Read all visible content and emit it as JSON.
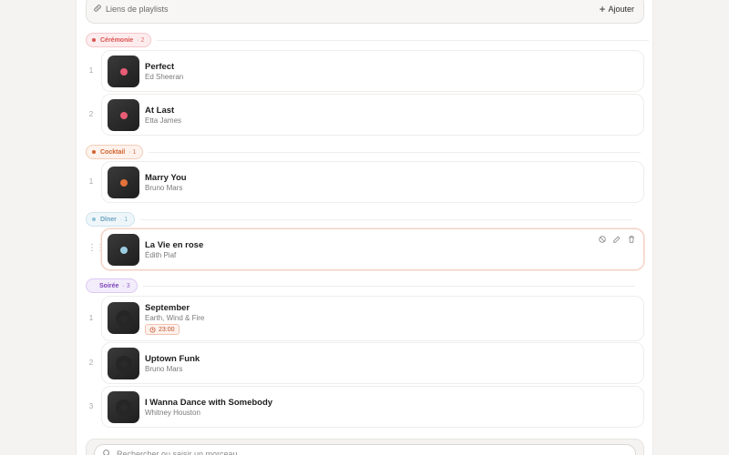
{
  "links_bar": {
    "label": "Liens de playlists",
    "add_label": "Ajouter"
  },
  "sections": [
    {
      "name": "Cérémonie",
      "count": "2",
      "color": "#d9534f",
      "bg": "#fdecee",
      "border": "#f5c6cb",
      "tracks": [
        {
          "index": "1",
          "title": "Perfect",
          "artist": "Ed Sheeran",
          "disc": "#e85c75"
        },
        {
          "index": "2",
          "title": "At Last",
          "artist": "Etta James",
          "disc": "#e85c75"
        }
      ]
    },
    {
      "name": "Cocktail",
      "count": "1",
      "color": "#d0632f",
      "bg": "#fdf2ec",
      "border": "#f3cdb8",
      "tracks": [
        {
          "index": "1",
          "title": "Marry You",
          "artist": "Bruno Mars",
          "disc": "#e3713a"
        }
      ]
    },
    {
      "name": "Dîner",
      "count": "1",
      "color": "#6ea3bf",
      "bg": "#eef6fa",
      "border": "#cfe3ee",
      "tracks": [
        {
          "title": "La Vie en rose",
          "artist": "Édith Piaf",
          "disc": "#9bcde0"
        }
      ]
    },
    {
      "name": "Soirée",
      "count": "3",
      "color": "#7b45b8",
      "bg": "#f3ecfb",
      "border": "#ddc9f2",
      "tracks": [
        {
          "index": "1",
          "title": "September",
          "artist": "Earth, Wind & Fire",
          "time": "23:00"
        },
        {
          "index": "2",
          "title": "Uptown Funk",
          "artist": "Bruno Mars"
        },
        {
          "index": "3",
          "title": "I Wanna Dance with Somebody",
          "artist": "Whitney Houston"
        }
      ]
    }
  ],
  "search": {
    "placeholder": "Rechercher ou saisir un morceau"
  }
}
